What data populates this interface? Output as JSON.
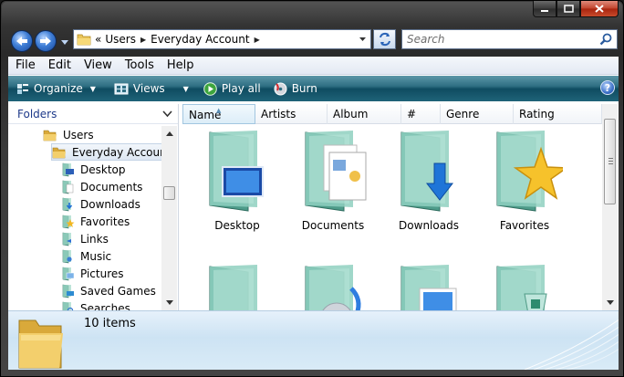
{
  "window": {
    "caption_buttons": [
      "minimize",
      "maximize",
      "close"
    ]
  },
  "navigation": {
    "address_chevron": "«",
    "breadcrumb": [
      "Users",
      "Everyday Account"
    ],
    "search_placeholder": "Search"
  },
  "menu": [
    "File",
    "Edit",
    "View",
    "Tools",
    "Help"
  ],
  "toolbar": {
    "organize_label": "Organize",
    "views_label": "Views",
    "play_all_label": "Play all",
    "burn_label": "Burn",
    "help_glyph": "?"
  },
  "nav_pane": {
    "header": "Folders",
    "items": [
      {
        "label": "Users",
        "icon": "folder-icon"
      },
      {
        "label": "Everyday Account",
        "icon": "folder-open-icon",
        "selected": true
      },
      {
        "label": "Desktop",
        "icon": "desktop-folder-icon"
      },
      {
        "label": "Documents",
        "icon": "documents-folder-icon"
      },
      {
        "label": "Downloads",
        "icon": "downloads-folder-icon"
      },
      {
        "label": "Favorites",
        "icon": "favorites-folder-icon"
      },
      {
        "label": "Links",
        "icon": "links-folder-icon"
      },
      {
        "label": "Music",
        "icon": "music-folder-icon"
      },
      {
        "label": "Pictures",
        "icon": "pictures-folder-icon"
      },
      {
        "label": "Saved Games",
        "icon": "saved-games-folder-icon"
      },
      {
        "label": "Searches",
        "icon": "searches-folder-icon"
      }
    ]
  },
  "columns": [
    "Name",
    "Artists",
    "Album",
    "#",
    "Genre",
    "Rating"
  ],
  "files": [
    {
      "label": "Desktop",
      "icon": "desktop-folder-icon"
    },
    {
      "label": "Documents",
      "icon": "documents-folder-icon"
    },
    {
      "label": "Downloads",
      "icon": "downloads-folder-icon"
    },
    {
      "label": "Favorites",
      "icon": "favorites-folder-icon"
    },
    {
      "label": "",
      "icon": "links-folder-icon"
    },
    {
      "label": "",
      "icon": "music-folder-icon"
    },
    {
      "label": "",
      "icon": "pictures-folder-icon"
    },
    {
      "label": "",
      "icon": "saved-games-folder-icon"
    }
  ],
  "details": {
    "count": "10 items"
  },
  "colors": {
    "toolbar": "#1f6378",
    "folder_green": "#7fc7b4",
    "accent_blue": "#3e72c9"
  }
}
